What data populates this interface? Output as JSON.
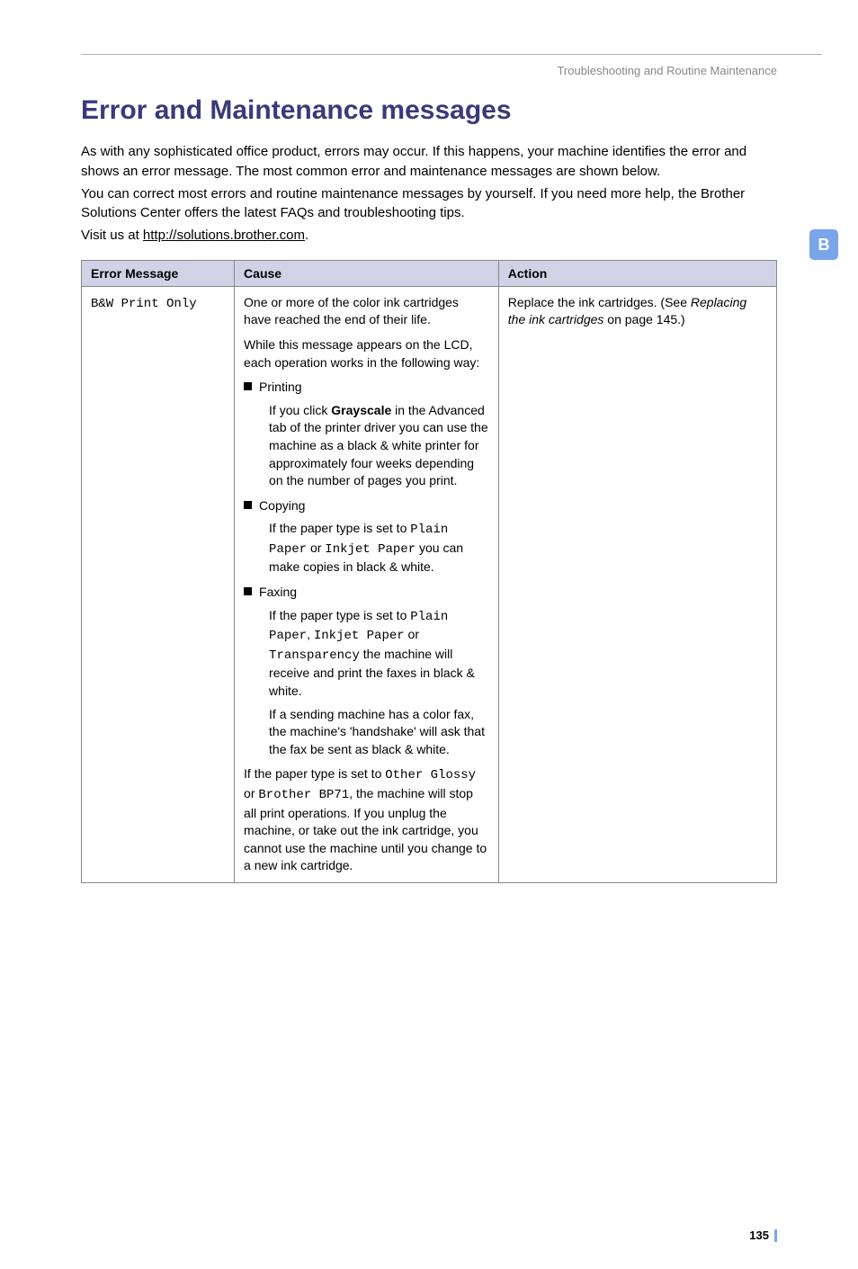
{
  "breadcrumb": "Troubleshooting and Routine Maintenance",
  "side_tab": "B",
  "heading": "Error and Maintenance messages",
  "intro_p1": "As with any sophisticated office product, errors may occur. If this happens, your machine identifies the error and shows an error message. The most common error and maintenance messages are shown below.",
  "intro_p2": "You can correct most errors and routine maintenance messages by yourself. If you need more help, the Brother Solutions Center offers the latest FAQs and troubleshooting tips.",
  "intro_visit": "Visit us at ",
  "intro_link": "http://solutions.brother.com",
  "intro_period": ".",
  "table": {
    "headers": {
      "c1": "Error Message",
      "c2": "Cause",
      "c3": "Action"
    },
    "row": {
      "error_msg": "B&W Print Only",
      "cause": {
        "p1": "One or more of the color ink cartridges have reached the end of their life.",
        "p2": "While this message appears on the LCD, each operation works in the following way:",
        "b1_label": "Printing",
        "b1_text_pre": "If you click ",
        "b1_bold": "Grayscale",
        "b1_text_post": " in the Advanced tab of the printer driver you can use the machine as a black & white printer for approximately four weeks depending on the number of pages you print.",
        "b2_label": "Copying",
        "b2_t1": "If the paper type is set to ",
        "b2_m1": "Plain Paper",
        "b2_t2": " or ",
        "b2_m2": "Inkjet Paper",
        "b2_t3": " you can make copies in black & white.",
        "b3_label": "Faxing",
        "b3_t1": "If the paper type is set to ",
        "b3_m1": "Plain Paper",
        "b3_t1b": ", ",
        "b3_m2": "Inkjet Paper",
        "b3_t2": " or ",
        "b3_m3": "Transparency",
        "b3_t3": " the machine will receive and print the faxes in black & white.",
        "b3_p2": "If a sending machine has a color fax, the machine's 'handshake' will ask that the fax be sent as black & white.",
        "p3_t1": "If the paper type is set to ",
        "p3_m1": "Other Glossy",
        "p3_t2": " or ",
        "p3_m2": "Brother BP71",
        "p3_t3": ", the machine will stop all print operations. If you unplug the machine, or take out the ink cartridge, you cannot use the machine until you change to a new ink cartridge."
      },
      "action": {
        "t1": "Replace the ink cartridges. (See ",
        "italic": "Replacing the ink cartridges",
        "t2": " on page 145.)"
      }
    }
  },
  "page_number": "135"
}
